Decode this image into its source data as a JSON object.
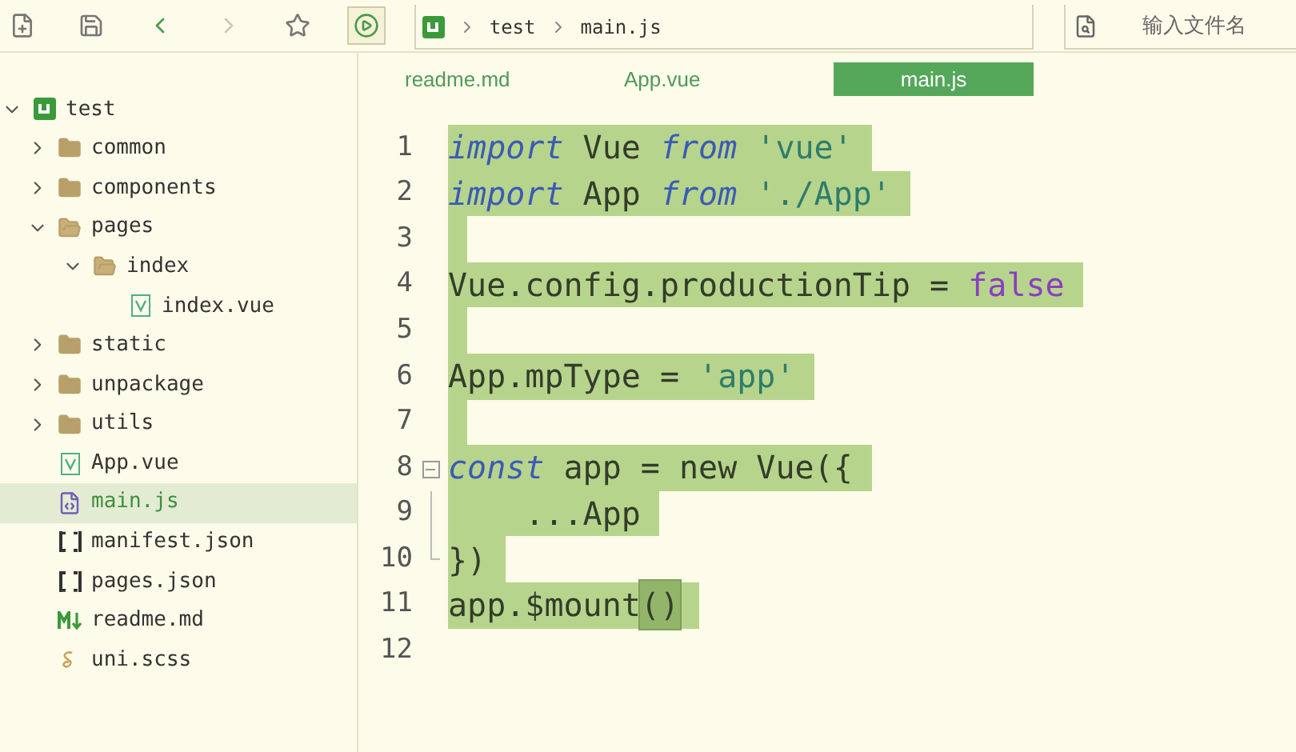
{
  "toolbar": {
    "buttons": [
      {
        "kind": "new-file",
        "selected": false
      },
      {
        "kind": "save",
        "selected": false
      },
      {
        "kind": "back",
        "selected": false
      },
      {
        "kind": "forward",
        "selected": false
      },
      {
        "kind": "star",
        "selected": false
      },
      {
        "kind": "run",
        "selected": true
      }
    ]
  },
  "breadcrumb": {
    "items": [
      "test",
      "main.js"
    ]
  },
  "search": {
    "placeholder": "输入文件名"
  },
  "tree": [
    {
      "name": "test",
      "kind": "project",
      "expanded": true,
      "selected": false,
      "children": [
        {
          "name": "common",
          "kind": "folder",
          "expanded": false,
          "selected": false
        },
        {
          "name": "components",
          "kind": "folder",
          "expanded": false,
          "selected": false
        },
        {
          "name": "pages",
          "kind": "folder",
          "expanded": true,
          "selected": false,
          "children": [
            {
              "name": "index",
              "kind": "folder",
              "expanded": true,
              "selected": false,
              "children": [
                {
                  "name": "index.vue",
                  "kind": "vue",
                  "selected": false
                }
              ]
            }
          ]
        },
        {
          "name": "static",
          "kind": "folder",
          "expanded": false,
          "selected": false
        },
        {
          "name": "unpackage",
          "kind": "folder",
          "expanded": false,
          "selected": false
        },
        {
          "name": "utils",
          "kind": "folder",
          "expanded": false,
          "selected": false
        },
        {
          "name": "App.vue",
          "kind": "vue",
          "selected": false
        },
        {
          "name": "main.js",
          "kind": "js",
          "selected": true
        },
        {
          "name": "manifest.json",
          "kind": "json",
          "selected": false
        },
        {
          "name": "pages.json",
          "kind": "json",
          "selected": false
        },
        {
          "name": "readme.md",
          "kind": "md",
          "selected": false
        },
        {
          "name": "uni.scss",
          "kind": "scss",
          "selected": false
        }
      ]
    }
  ],
  "tabs": [
    {
      "label": "readme.md",
      "selected": false
    },
    {
      "label": "App.vue",
      "selected": false
    },
    {
      "label": "main.js",
      "selected": true
    }
  ],
  "editor": {
    "lines": [
      {
        "number": "1",
        "selected": true,
        "kind": "plain",
        "tokens": [
          {
            "text": "import",
            "kind": "keyword"
          },
          {
            "text": " Vue ",
            "kind": "plain"
          },
          {
            "text": "from",
            "kind": "keyword"
          },
          {
            "text": " 'vue'",
            "kind": "string"
          }
        ]
      },
      {
        "number": "2",
        "selected": true,
        "kind": "plain",
        "tokens": [
          {
            "text": "import",
            "kind": "keyword"
          },
          {
            "text": " App ",
            "kind": "plain"
          },
          {
            "text": "from",
            "kind": "keyword"
          },
          {
            "text": " './App'",
            "kind": "string"
          }
        ]
      },
      {
        "number": "3",
        "selected": true,
        "kind": "plain"
      },
      {
        "number": "4",
        "selected": true,
        "kind": "plain",
        "tokens": [
          {
            "text": "Vue.config.productionTip = ",
            "kind": "plain"
          },
          {
            "text": "false",
            "kind": "literal"
          }
        ]
      },
      {
        "number": "5",
        "selected": true,
        "kind": "plain"
      },
      {
        "number": "6",
        "selected": true,
        "kind": "plain",
        "tokens": [
          {
            "text": "App.mpType = ",
            "kind": "plain"
          },
          {
            "text": "'app'",
            "kind": "string"
          }
        ]
      },
      {
        "number": "7",
        "selected": true,
        "kind": "plain"
      },
      {
        "number": "8",
        "selected": true,
        "kind": "fold-start",
        "tokens": [
          {
            "text": "const",
            "kind": "keyword"
          },
          {
            "text": " app = new Vue({",
            "kind": "plain"
          }
        ]
      },
      {
        "number": "9",
        "selected": true,
        "kind": "fold-inside",
        "tokens": [
          {
            "text": "    ...App",
            "kind": "plain"
          }
        ]
      },
      {
        "number": "10",
        "selected": true,
        "kind": "fold-end",
        "tokens": [
          {
            "text": "})",
            "kind": "plain"
          }
        ]
      },
      {
        "number": "11",
        "selected": true,
        "kind": "plain",
        "tokens": [
          {
            "text": "app.$mount",
            "kind": "plain"
          },
          {
            "text": "()",
            "kind": "bracket-match"
          }
        ]
      },
      {
        "number": "12",
        "selected": false,
        "kind": "plain"
      }
    ]
  }
}
